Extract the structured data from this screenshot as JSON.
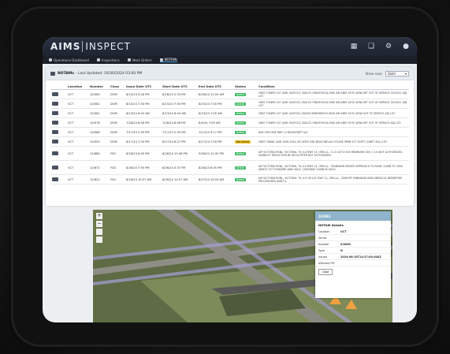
{
  "app": {
    "logo_main": "AIMS",
    "logo_sub": "INSPECT"
  },
  "topbar_icons": [
    "grid-icon",
    "paint-icon",
    "gear-icon",
    "user-icon"
  ],
  "nav": [
    {
      "label": "Operations Dashboard",
      "icon": "dashboard-icon",
      "active": false
    },
    {
      "label": "Inspections",
      "icon": "clipboard-icon",
      "active": false
    },
    {
      "label": "Work Orders",
      "icon": "wrench-icon",
      "active": false
    },
    {
      "label": "NOTAMs",
      "icon": "notam-icon",
      "active": true
    }
  ],
  "card": {
    "title": "NOTAMs",
    "updated": "- Last Updated: 10/30/2024 03:00 PM",
    "show_label": "Show rows",
    "show_value": "Valid"
  },
  "table": {
    "headers": [
      "Location",
      "Number",
      "Class",
      "Issue Date UTC",
      "Start Date UTC",
      "End Date UTC",
      "Status",
      "Condition"
    ],
    "rows": [
      {
        "loc": "VCT",
        "num": "10/083",
        "cls": "DOM",
        "issue": "8/15/24 9:28 PM",
        "start": "8/16/24 2:33 PM",
        "end": "8/16/24 12:00 AM",
        "status": "Active",
        "cond": "OBST TOWER LGT (ASR 1049723) 284125.70N0970024.09W (SN AMM 1075) WSW APT OUT OF SERVICE 2425011 ADJ LGT."
      },
      {
        "loc": "VCT",
        "num": "10/082",
        "cls": "DOM",
        "issue": "8/15/24 7:50 PM",
        "start": "8/15/24 7:50 PM",
        "end": "8/15/24 7:50 PM",
        "status": "Active",
        "cond": "OBST TOWER LGT (ASR 1049723) 284125.70N0970024.09W (SN AMM 1075) WSW APT OUT OF SERVICE 2425011 ADJ LGT."
      },
      {
        "loc": "VCT",
        "num": "10/081",
        "cls": "DOM",
        "issue": "8/13/24 6:04 AM",
        "start": "8/13/24 6:04 AM",
        "end": "8/13/24 7:05 AM",
        "status": "Active",
        "cond": "OBST TOWER LGT (ASR 1049720) 284003.89N0965913.82W (SN AMM 1075) WSW OUT OF SERVICE ADJ LGT."
      },
      {
        "loc": "VCT",
        "num": "10/078",
        "cls": "DOM",
        "issue": "7/28/24 8:08 PM",
        "start": "7/28/24 8:08 PM",
        "end": "8/5/24 7:59 AM",
        "status": "Active",
        "cond": "OBST TOWER LGT (ASR 1049723) 284125.70N0970024.09W (SN AMM 1075) WSW APT OUT OF SERVICE ADJ LGT."
      },
      {
        "loc": "VCT",
        "num": "10/068",
        "cls": "DOM",
        "issue": "7/17/24 2:35 PM",
        "start": "7/17/24 2:35 PM",
        "end": "12/7/24 3:17 PM",
        "status": "Active",
        "cond": "NAV VOR DME RWY 12 BCKSKRDPT U/S"
      },
      {
        "loc": "VCT",
        "num": "10/050",
        "cls": "DOM",
        "issue": "6/17/24 7:33 PM",
        "start": "6/17/24 8:27 PM",
        "end": "6/17/24 7:59 PM",
        "status": "Not Active",
        "cond": "OBST CRANE (ASR 1049-2024-OE) WITH OBS BEACONFLAG 072ASK IRMN VCT 200FT (168FT AGL) LGT."
      },
      {
        "loc": "VCT",
        "num": "12/680",
        "cls": "FDC",
        "issue": "8/26/24 8:35 PM",
        "start": "8/26/24 10:38 PM",
        "end": "9/26/24 12:35 PM",
        "status": "Active",
        "cond": "IAP VICTORIA RGNL, VICTORIA, TX. ILS RWY 13, ORIG-A... S-13 CAT D 500 MINIMUMS 300, 1 1/4 NOT AUTHORIZED. VISIBILITY REDUCTION BY HELICOPTER NOT AUTHORIZED."
      },
      {
        "loc": "VCT",
        "num": "12/672",
        "cls": "FDC",
        "issue": "8/26/24 7:55 PM",
        "start": "8/26/24 4:37 PM",
        "end": "8/26/24 6:35 PM",
        "status": "Active",
        "cond": "IAP VICTORIA RGNL, VICTORIA, TX. ILS RWY 12, ORIG-A... STANDARD MISSED APPROACH TO READ: CLIMB TO 2000 DIRECT VCT VOR/DME AND HOLD. CONTINUE CLIMB IN HOLD."
      },
      {
        "loc": "VCT",
        "num": "12/622",
        "cls": "FDC",
        "issue": "8/26/24 10:57 AM",
        "start": "8/26/24 10:57 AM",
        "end": "8/27/24 10:59 AM",
        "status": "Active",
        "cond": "IAP VICTORIA RGNL, VICTORIA, TX. ILS OR LOC RWY 12, ORIG-A... TAKEOFF MINIMUMS AND OBSTACLE DEPARTURE PROCEDURES AMDT 4."
      }
    ]
  },
  "map_panel": {
    "header": "10/083",
    "section": "NOTAM Details",
    "fields": [
      {
        "label": "Location",
        "value": "VCT"
      },
      {
        "label": "Series",
        "value": ""
      },
      {
        "label": "Number",
        "value": "0/0083"
      },
      {
        "label": "Type",
        "value": "N"
      },
      {
        "label": "Issued",
        "value": "2024-08-16T14:27:00.000Z"
      },
      {
        "label": "Affected FIR",
        "value": ""
      }
    ],
    "close_label": "Close"
  },
  "colors": {
    "header_bg": "#222a36",
    "active_badge": "#3dba64",
    "inactive_badge": "#f2c11c",
    "map_panel_header": "#8fb4cc"
  }
}
